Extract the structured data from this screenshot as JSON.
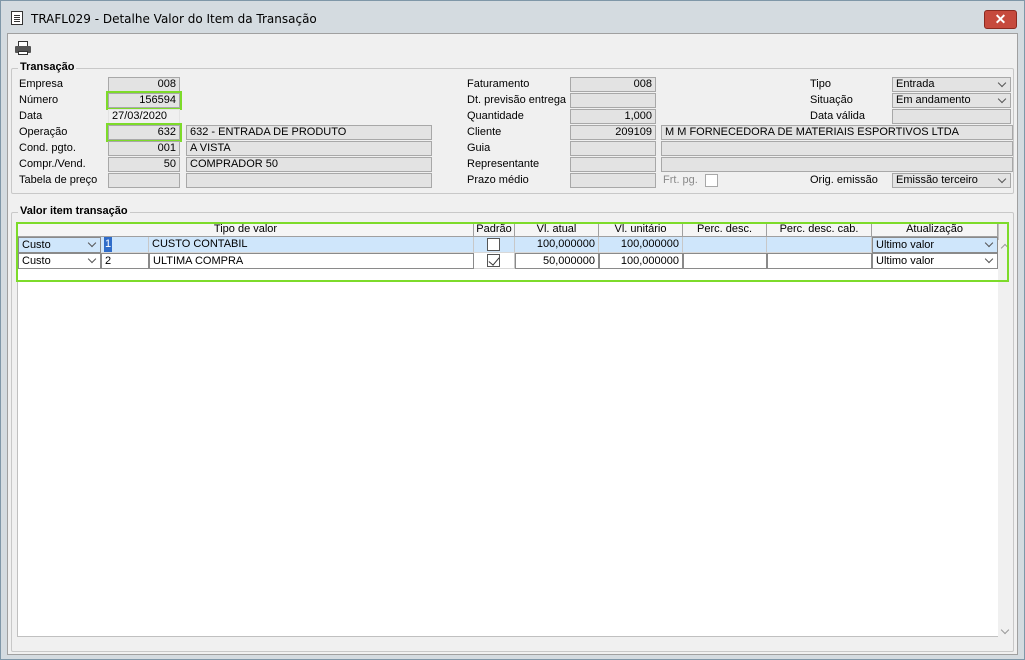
{
  "window": {
    "title": "TRAFL029 - Detalhe Valor do Item da Transação",
    "close": "✕"
  },
  "transacao": {
    "title": "Transação",
    "labels": {
      "empresa": "Empresa",
      "numero": "Número",
      "data": "Data",
      "operacao": "Operação",
      "cond_pgto": "Cond. pgto.",
      "compr_vend": "Compr./Vend.",
      "tabela_preco": "Tabela de preço",
      "faturamento": "Faturamento",
      "dt_previsao": "Dt. previsão entrega",
      "quantidade": "Quantidade",
      "cliente": "Cliente",
      "guia": "Guia",
      "representante": "Representante",
      "prazo_medio": "Prazo médio",
      "frt_pg": "Frt. pg.",
      "tipo": "Tipo",
      "situacao": "Situação",
      "data_valida": "Data válida",
      "orig_emissao": "Orig. emissão"
    },
    "values": {
      "empresa": "008",
      "numero": "156594",
      "data": "27/03/2020",
      "operacao_code": "632",
      "operacao_desc": "632 - ENTRADA DE PRODUTO",
      "cond_pgto_code": "001",
      "cond_pgto_desc": "A VISTA",
      "compr_vend_code": "50",
      "compr_vend_desc": "COMPRADOR 50",
      "tabela_preco_code": "",
      "tabela_preco_desc": "",
      "faturamento": "008",
      "dt_previsao": "",
      "quantidade": "1,000",
      "cliente_code": "209109",
      "cliente_desc": "M M    FORNECEDORA DE MATERIAIS ESPORTIVOS  LTDA",
      "guia_code": "",
      "guia_desc": "",
      "representante_code": "",
      "representante_desc": "",
      "prazo_medio": "",
      "tipo": "Entrada",
      "situacao": "Em andamento",
      "data_valida": "",
      "orig_emissao": "Emissão terceiro"
    }
  },
  "valor_item": {
    "title": "Valor item transação",
    "columns": [
      "Tipo de valor",
      "Padrão",
      "Vl. atual",
      "Vl. unitário",
      "Perc. desc.",
      "Perc. desc. cab.",
      "Atualização"
    ],
    "rows": [
      {
        "tipo": "Custo",
        "seq": "1",
        "desc": "CUSTO CONTABIL",
        "padrao": false,
        "vl_atual": "100,000000",
        "vl_unit": "100,000000",
        "perc_desc": "",
        "perc_desc_cab": "",
        "atualizacao": "Ultimo valor"
      },
      {
        "tipo": "Custo",
        "seq": "2",
        "desc": "ULTIMA COMPRA",
        "padrao": true,
        "vl_atual": "50,000000",
        "vl_unit": "100,000000",
        "perc_desc": "",
        "perc_desc_cab": "",
        "atualizacao": "Ultimo valor"
      }
    ]
  },
  "icons": {
    "document": "document-icon",
    "printer": "printer-icon",
    "close": "close-icon",
    "dropdown": "chevron-down-icon"
  },
  "colors": {
    "highlight": "#7ddb2a",
    "selected_row": "#cfe6fb",
    "close_button": "#c64a3d"
  }
}
